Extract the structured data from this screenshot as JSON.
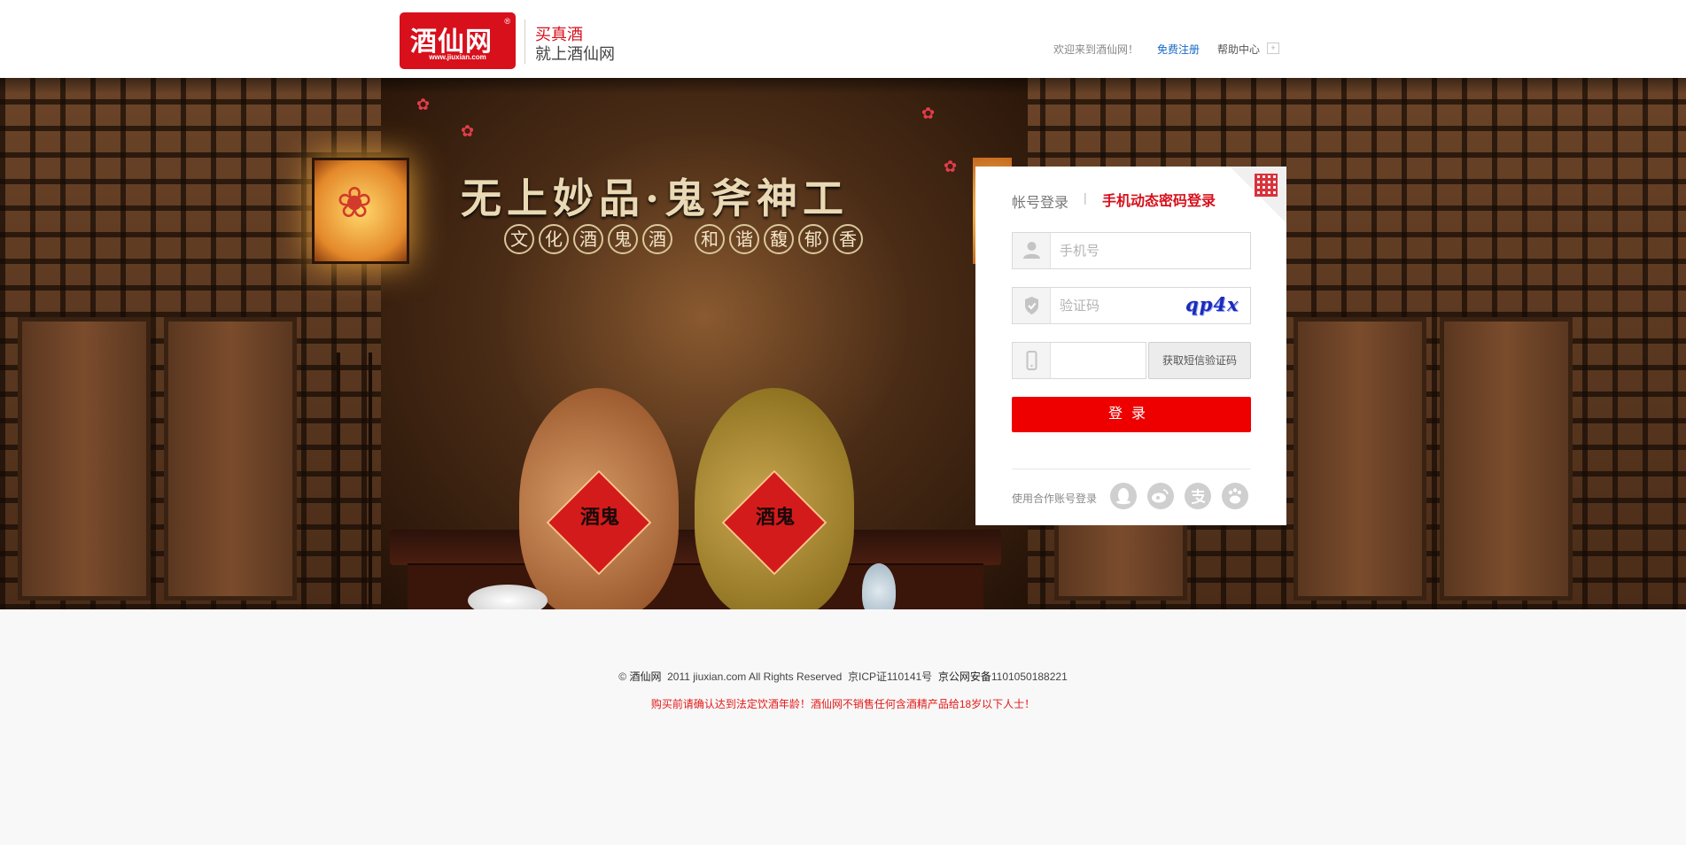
{
  "header": {
    "logo_text": "酒仙网",
    "logo_registered": "®",
    "logo_url": "www.jiuxian.com",
    "slogan_line1": "买真酒",
    "slogan_line2": "就上酒仙网",
    "welcome": "欢迎来到酒仙网！",
    "register_link": "免费注册",
    "help_link": "帮助中心",
    "help_arrow": "+"
  },
  "banner": {
    "title": "无上妙品·鬼斧神工",
    "circles_left": [
      "文",
      "化",
      "酒",
      "鬼",
      "酒"
    ],
    "circles_right": [
      "和",
      "谐",
      "馥",
      "郁",
      "香"
    ],
    "sack_label_left": "酒鬼",
    "sack_label_right": "酒鬼"
  },
  "login": {
    "tab_account": "帐号登录",
    "tab_separator": "|",
    "tab_sms": "手机动态密码登录",
    "phone_placeholder": "手机号",
    "captcha_placeholder": "验证码",
    "captcha_text": "qp4x",
    "sms_placeholder": "",
    "sms_button": "获取短信验证码",
    "login_button": "登录",
    "partner_label": "使用合作账号登录",
    "partners": [
      "qq-icon",
      "weibo-icon",
      "alipay-icon",
      "baidu-icon"
    ]
  },
  "footer": {
    "copyright_symbol": "©",
    "brand": "酒仙网",
    "rights": "2011 jiuxian.com All Rights Reserved",
    "icp": "京ICP证110141号",
    "police_label": "京公网安备",
    "police_number": "1101050188221",
    "warning": "购买前请确认达到法定饮酒年龄！酒仙网不销售任何含酒精产品给18岁以下人士！"
  },
  "colors": {
    "brand_red": "#d7101c",
    "link_blue": "#1568c7",
    "login_button": "#ee0000"
  }
}
